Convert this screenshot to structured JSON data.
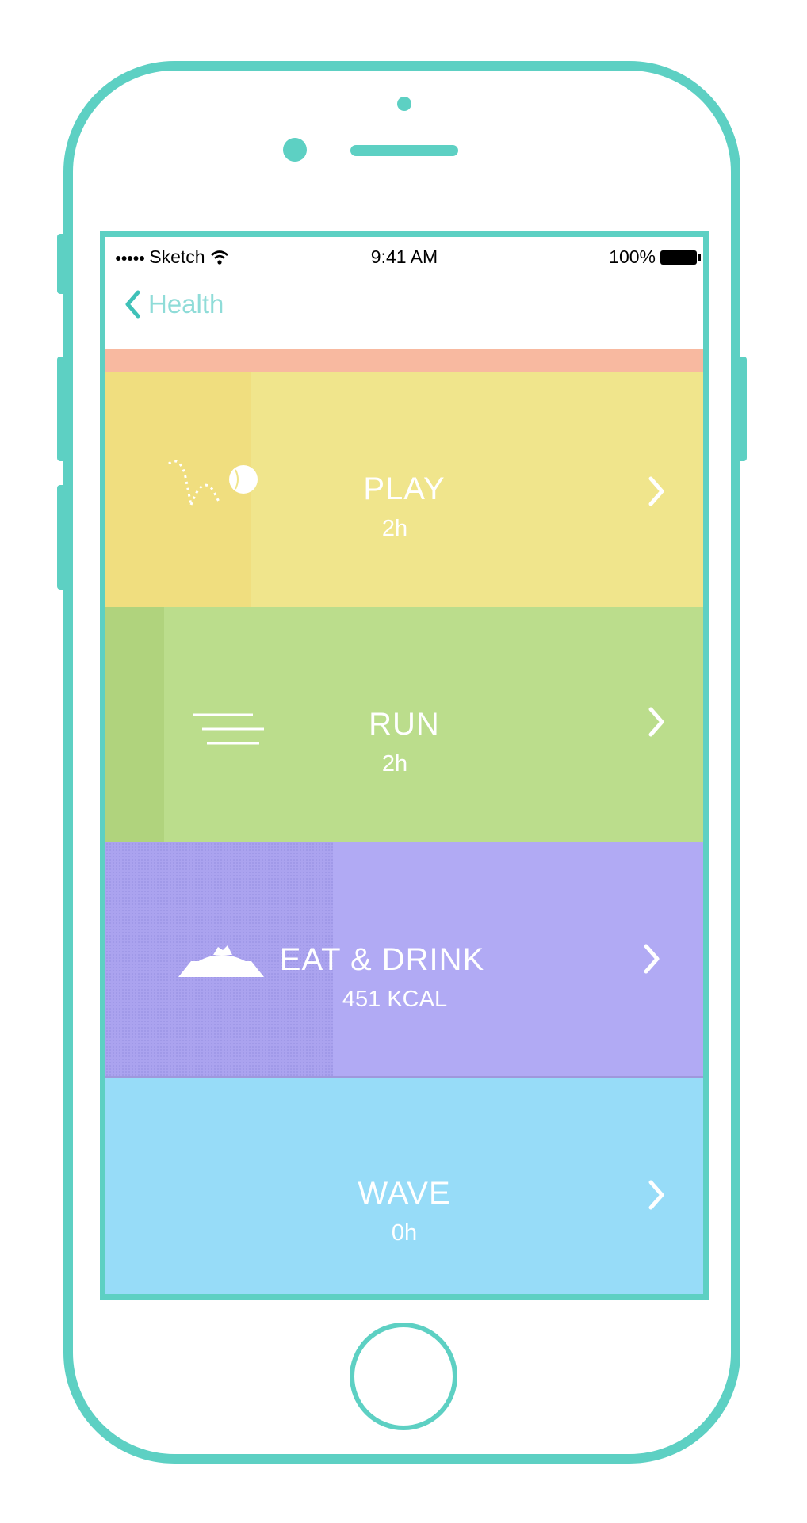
{
  "status_bar": {
    "signal": "●●●●●",
    "carrier": "Sketch",
    "time": "9:41 AM",
    "battery": "100%"
  },
  "nav": {
    "back_label": "Health"
  },
  "activities": [
    {
      "title": "PLAY",
      "value": "2h",
      "icon": "ball-bounce-icon"
    },
    {
      "title": "RUN",
      "value": "2h",
      "icon": "speed-lines-icon"
    },
    {
      "title": "EAT & DRINK",
      "value": "451 KCAL",
      "icon": "food-bowl-icon"
    },
    {
      "title": "WAVE",
      "value": "0h",
      "icon": ""
    }
  ],
  "colors": {
    "frame": "#5dd0c3",
    "coral": "#f8b9a0",
    "play": "#f0e58c",
    "run": "#bbdd8c",
    "eat": "#b1aaf4",
    "wave": "#97dcf8",
    "back_link": "#8fdcd8"
  }
}
